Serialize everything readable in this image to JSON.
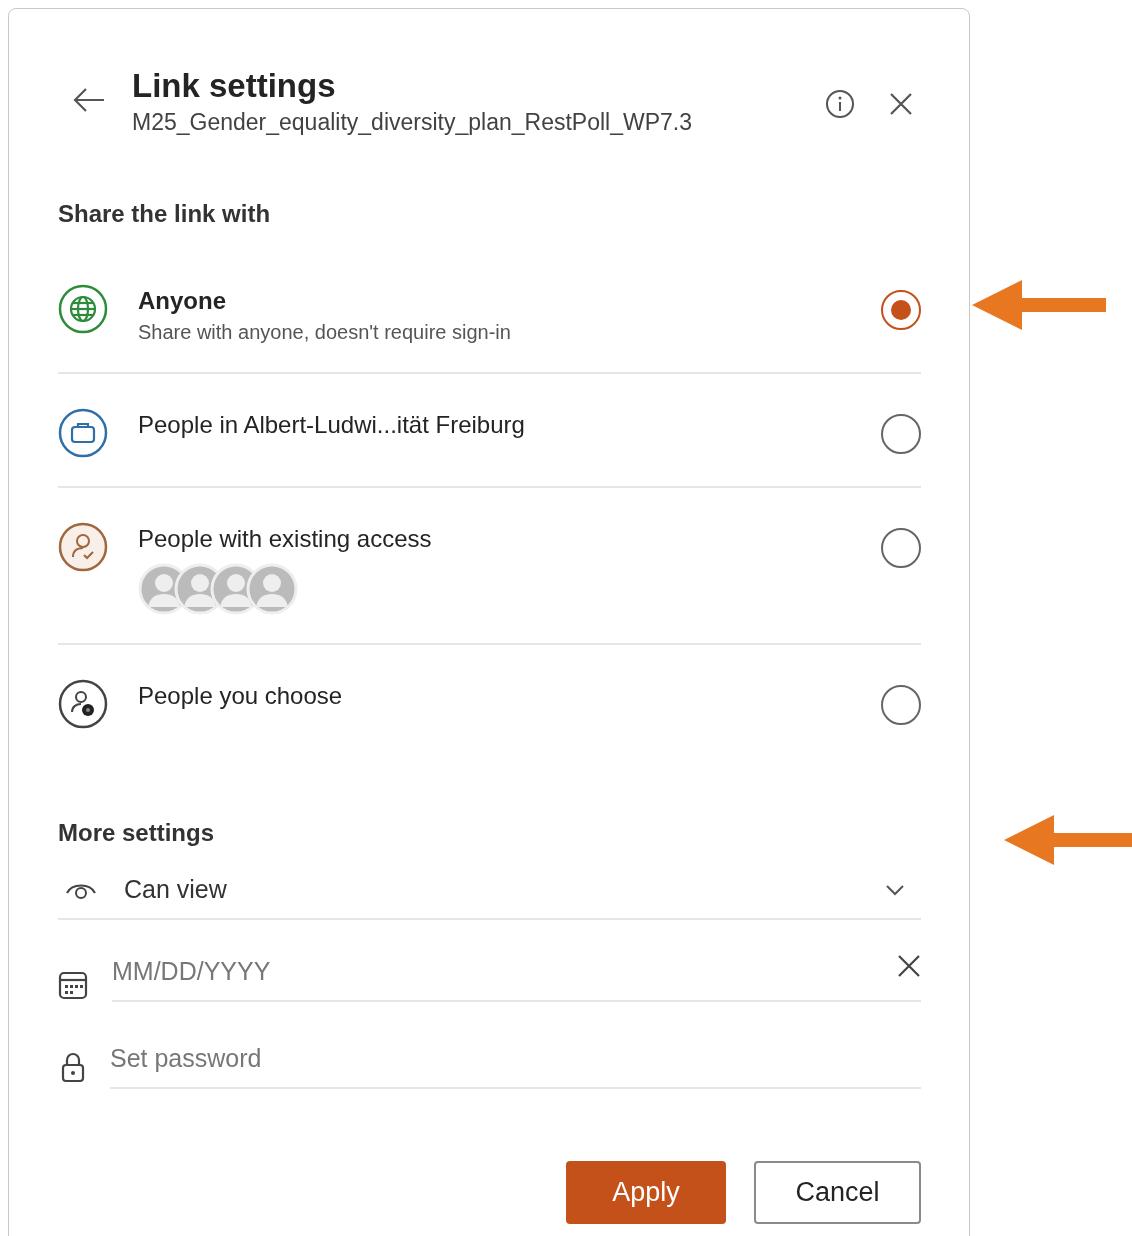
{
  "header": {
    "title": "Link settings",
    "subtitle": "M25_Gender_equality_diversity_plan_RestPoll_WP7.3"
  },
  "share": {
    "heading": "Share the link with",
    "options": [
      {
        "kind": "globe",
        "title": "Anyone",
        "description": "Share with anyone, doesn't require sign-in",
        "selected": true,
        "shows_avatars": false
      },
      {
        "kind": "organization",
        "title": "People in Albert-Ludwi...ität Freiburg",
        "selected": false,
        "shows_avatars": false
      },
      {
        "kind": "existing",
        "title": "People with existing access",
        "selected": false,
        "shows_avatars": true
      },
      {
        "kind": "choose",
        "title": "People you choose",
        "selected": false,
        "shows_avatars": false
      }
    ]
  },
  "more_settings": {
    "heading": "More settings",
    "permission": {
      "value": "Can view"
    },
    "expiry": {
      "placeholder": "MM/DD/YYYY"
    },
    "password": {
      "placeholder": "Set password"
    }
  },
  "buttons": [
    {
      "kind": "primary",
      "label": "Apply"
    },
    {
      "kind": "secondary",
      "label": "Cancel"
    }
  ]
}
